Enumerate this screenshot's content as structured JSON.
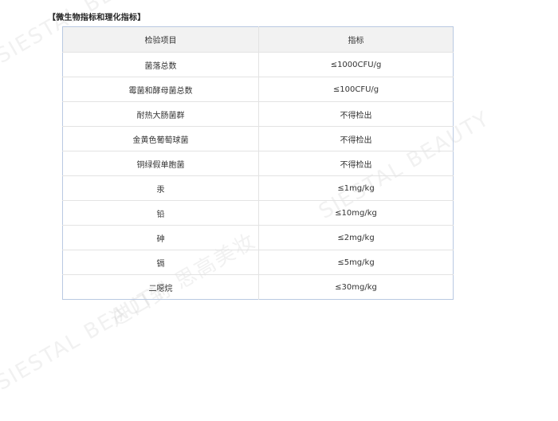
{
  "heading": "【微生物指标和理化指标】",
  "table": {
    "headers": [
      "检验项目",
      "指标"
    ],
    "rows": [
      [
        "菌落总数",
        "≤1000CFU/g"
      ],
      [
        "霉菌和酵母菌总数",
        "≤100CFU/g"
      ],
      [
        "耐热大肠菌群",
        "不得检出"
      ],
      [
        "金黄色葡萄球菌",
        "不得检出"
      ],
      [
        "铜绿假单胞菌",
        "不得检出"
      ],
      [
        "汞",
        "≤1mg/kg"
      ],
      [
        "铅",
        "≤10mg/kg"
      ],
      [
        "砷",
        "≤2mg/kg"
      ],
      [
        "镉",
        "≤5mg/kg"
      ],
      [
        "二噁烷",
        "≤30mg/kg"
      ]
    ]
  },
  "watermark": {
    "brand": "SIESTAL BEAUTY",
    "slogan": "进口到 思高美妆"
  }
}
